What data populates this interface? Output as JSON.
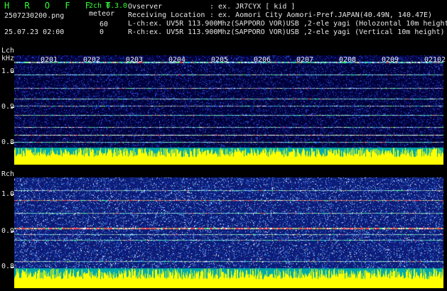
{
  "header": {
    "logo": "H R O F F T",
    "channels": "2ch 0.3.0",
    "filename": "2507230200.png",
    "mode_label": "meteor",
    "timestamp": "25.07.23 02:00",
    "count_1": "60",
    "count_2": "0",
    "observer_label": "Ovserver",
    "observer_value": ": ex. JR7CYX [ kid ]",
    "location_label": "Receiving Location",
    "location_value": ": ex. Aomori City Aomori-Pref.JAPAN(40.49N, 140.47E)",
    "lch_info": "L-ch:ex. UV5R 113.900Mhz(SAPPORO VOR)USB ,2-ele yagi (Holozontal 10m height",
    "rch_info": "R-ch:ex. UV5R 113.900Mhz(SAPPORO VOR)USB ,2-ele yagi (Vertical 10m height)"
  },
  "lch": {
    "label": "Lch",
    "unit": "kHz",
    "y_ticks": [
      "1.0",
      "0.9",
      "0.8"
    ],
    "time_labels": [
      "0201",
      "0202",
      "0203",
      "0204",
      "0205",
      "0206",
      "0207",
      "0208",
      "0209",
      "0210",
      "2"
    ]
  },
  "rch": {
    "label": "Rch",
    "y_ticks": [
      "1.0",
      "0.9",
      "0.8"
    ]
  },
  "colors": {
    "text_green": "#33ff33",
    "meter_yellow": "#ffff00",
    "lch_noise_bg": "#00003a",
    "rch_noise_bg": "#1a2a8a",
    "carrier_line": "#40c0ff"
  }
}
